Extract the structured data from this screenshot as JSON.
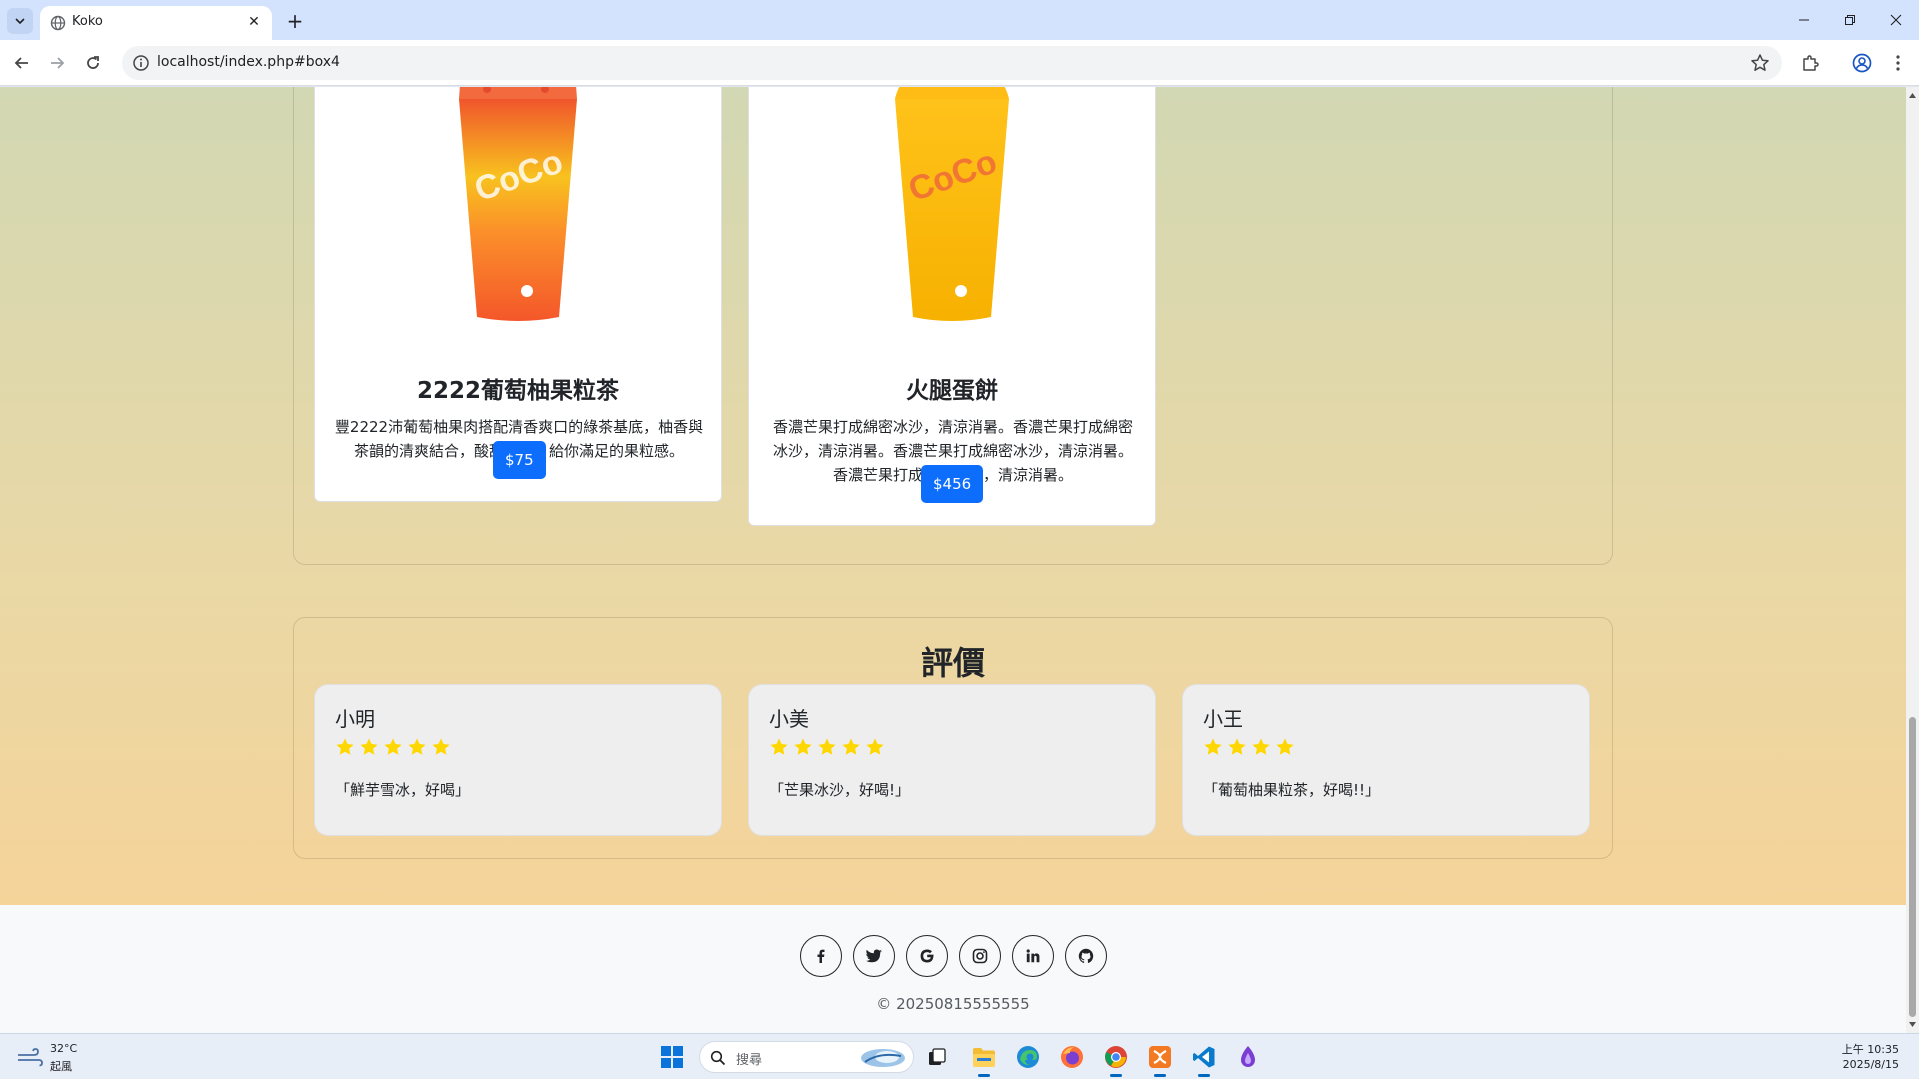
{
  "browser": {
    "tab_title": "Koko",
    "url": "localhost/index.php#box4"
  },
  "products": [
    {
      "name": "2222葡萄柚果粒茶",
      "description": "豐2222沛葡萄柚果肉搭配清香爽口的綠茶基底，柚香與茶韻的清爽結合，酸甜不澀，給你滿足的果粒感。",
      "price": "$75"
    },
    {
      "name": "火腿蛋餅",
      "description": "香濃芒果打成綿密冰沙，清涼消暑。香濃芒果打成綿密冰沙，清涼消暑。香濃芒果打成綿密冰沙，清涼消暑。香濃芒果打成綿密冰沙，清涼消暑。",
      "price": "$456"
    }
  ],
  "reviews": {
    "title": "評價",
    "items": [
      {
        "name": "小明",
        "stars": 5,
        "text": "「鮮芋雪冰，好喝」"
      },
      {
        "name": "小美",
        "stars": 5,
        "text": "「芒果冰沙，好喝!」"
      },
      {
        "name": "小王",
        "stars": 4,
        "text": "「葡萄柚果粒茶，好喝!!」"
      }
    ]
  },
  "footer": {
    "social_icons": [
      "facebook-icon",
      "twitter-icon",
      "google-icon",
      "instagram-icon",
      "linkedin-icon",
      "github-icon"
    ],
    "copyright": "© 20250815555555"
  },
  "taskbar": {
    "weather_temp": "32°C",
    "weather_desc": "起風",
    "search_placeholder": "搜尋",
    "time": "上午 10:35",
    "date": "2025/8/15"
  },
  "colors": {
    "accent": "#0d6efd",
    "star": "#ffd700",
    "footer_bg": "#f8f9fa"
  }
}
